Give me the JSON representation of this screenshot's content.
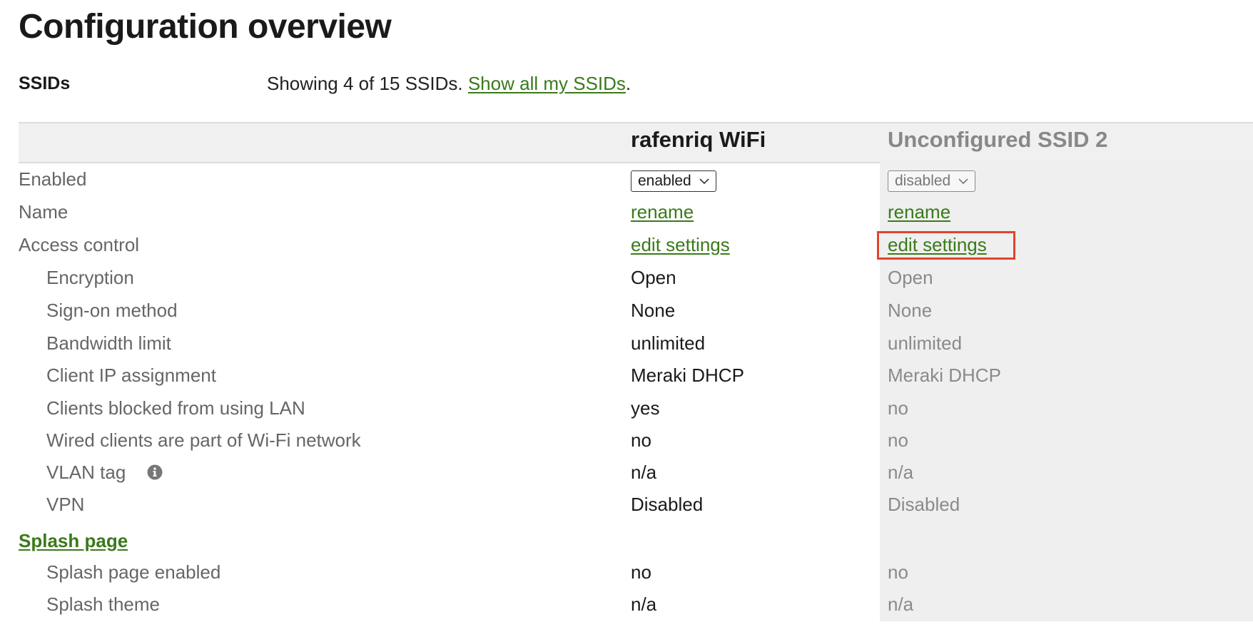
{
  "page_title": "Configuration overview",
  "section": {
    "label": "SSIDs",
    "showing_text": "Showing 4 of 15 SSIDs.",
    "show_all_link": "Show all my SSIDs",
    "trailing_period": "."
  },
  "ssids": [
    {
      "name": "rafenriq WiFi"
    },
    {
      "name": "Unconfigured SSID 2"
    }
  ],
  "rows": {
    "enabled": {
      "label": "Enabled",
      "v1": "enabled",
      "v2": "disabled"
    },
    "name": {
      "label": "Name",
      "v1": "rename",
      "v2": "rename"
    },
    "access_control": {
      "label": "Access control",
      "v1": "edit settings",
      "v2": "edit settings"
    },
    "encryption": {
      "label": "Encryption",
      "v1": "Open",
      "v2": "Open"
    },
    "sign_on": {
      "label": "Sign-on method",
      "v1": "None",
      "v2": "None"
    },
    "bandwidth": {
      "label": "Bandwidth limit",
      "v1": "unlimited",
      "v2": "unlimited"
    },
    "client_ip": {
      "label": "Client IP assignment",
      "v1": "Meraki DHCP",
      "v2": "Meraki DHCP"
    },
    "clients_blocked": {
      "label": "Clients blocked from using LAN",
      "v1": "yes",
      "v2": "no"
    },
    "wired_clients": {
      "label": "Wired clients are part of Wi-Fi network",
      "v1": "no",
      "v2": "no"
    },
    "vlan_tag": {
      "label": "VLAN tag",
      "v1": "n/a",
      "v2": "n/a"
    },
    "vpn": {
      "label": "VPN",
      "v1": "Disabled",
      "v2": "Disabled"
    },
    "splash_page": {
      "label": "Splash page"
    },
    "splash_enabled": {
      "label": "Splash page enabled",
      "v1": "no",
      "v2": "no"
    },
    "splash_theme": {
      "label": "Splash theme",
      "v1": "n/a",
      "v2": "n/a"
    }
  },
  "icons": {
    "vlan_info": "info-icon",
    "select_chevron": "chevron-down-icon"
  },
  "colors": {
    "link": "#3a7a1a",
    "highlight": "#e2432a",
    "header_band": "#f0f0f0",
    "disabled_column": "#efefef"
  }
}
